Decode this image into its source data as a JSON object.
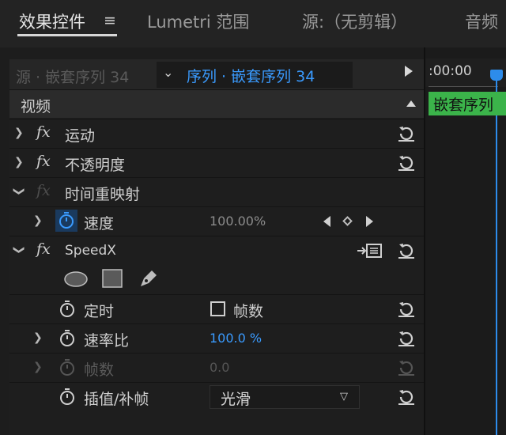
{
  "tabs": {
    "effect_controls": "效果控件",
    "menu_icon": "≡",
    "lumetri": "Lumetri 范围",
    "source": "源:（无剪辑）",
    "audio": "音频"
  },
  "sequence_bar": {
    "source_label": "源 · 嵌套序列 34",
    "sequence_label": "序列 · 嵌套序列 34",
    "chevron": "⌄"
  },
  "sections": {
    "video": "视频"
  },
  "effects": {
    "motion": {
      "fx": "fx",
      "label": "运动"
    },
    "opacity": {
      "fx": "fx",
      "label": "不透明度"
    },
    "time_remap": {
      "fx": "fx",
      "label": "时间重映射",
      "speed": {
        "label": "速度",
        "value": "100.00%"
      }
    },
    "speedx": {
      "fx": "fx",
      "label": "SpeedX",
      "params": {
        "timing": {
          "label": "定时",
          "checkbox_label": "帧数"
        },
        "rate": {
          "label": "速率比",
          "value": "100.0 %"
        },
        "frames": {
          "label": "帧数",
          "value": "0.0"
        },
        "interp": {
          "label": "插值/补帧",
          "value": "光滑"
        }
      }
    }
  },
  "timeline": {
    "time": ":00:00",
    "clip_label": "嵌套序列"
  },
  "colors": {
    "accent_blue": "#3a9bff",
    "clip_green": "#3bb34a",
    "playhead": "#2d8ceb"
  }
}
